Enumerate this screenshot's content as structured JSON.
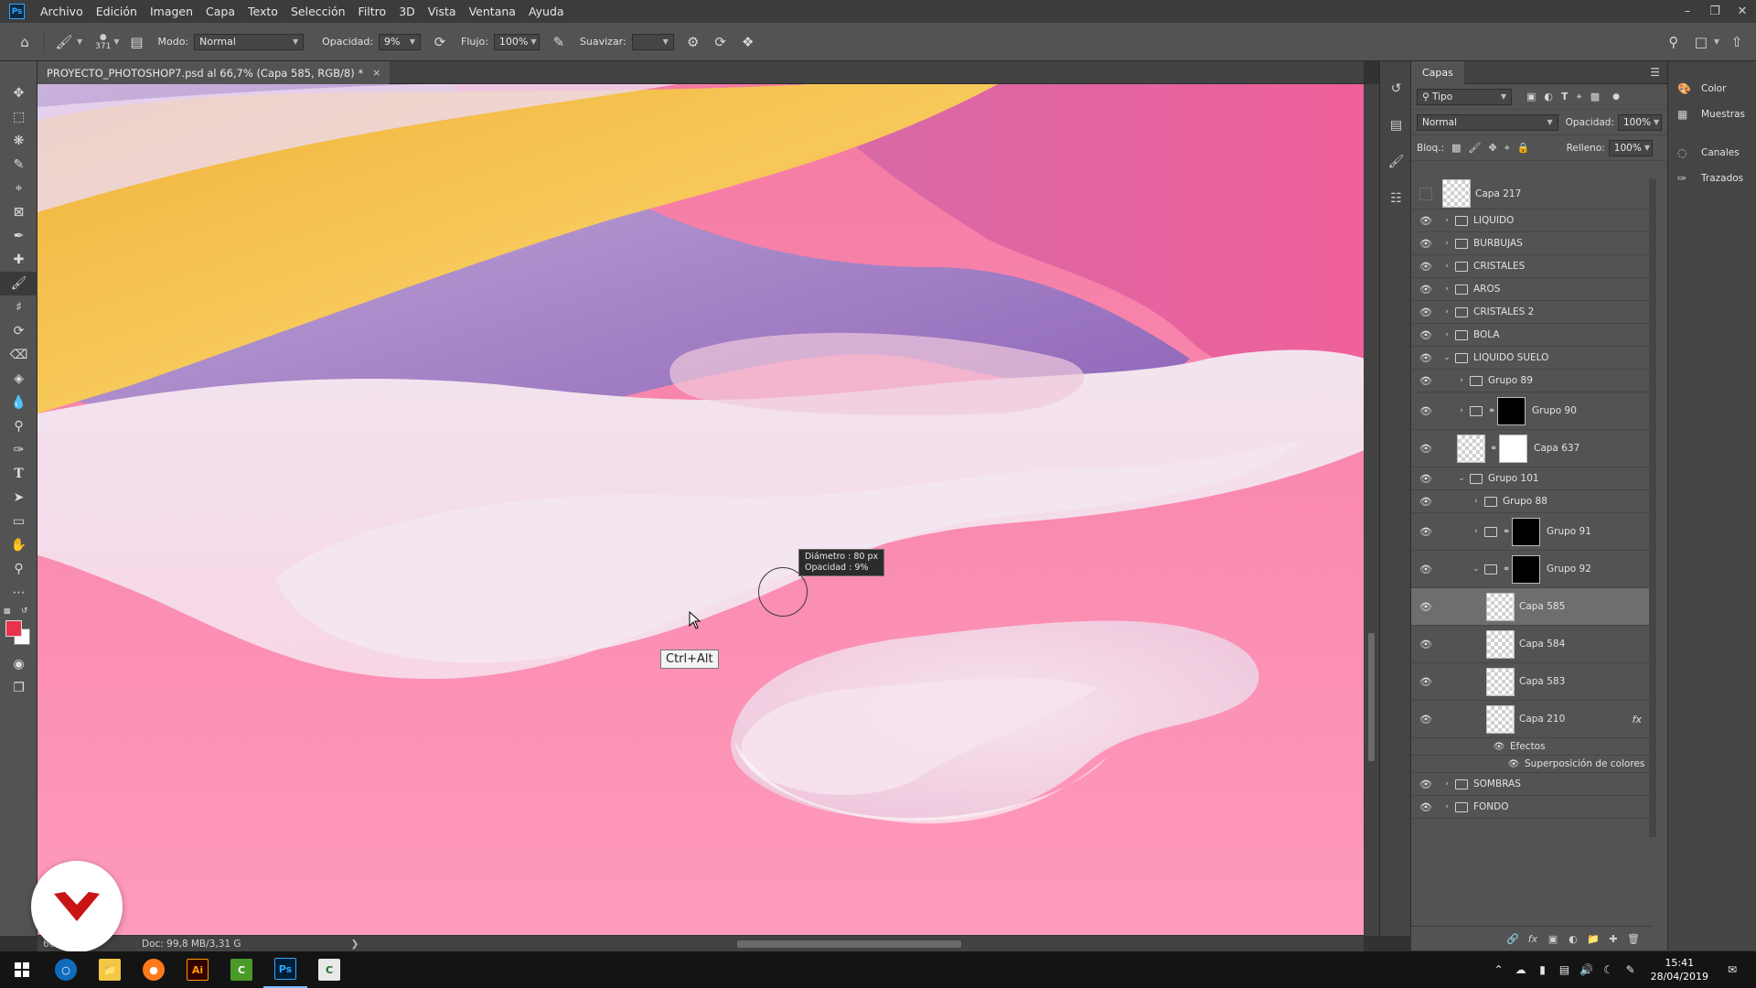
{
  "app": {
    "logo_text": "Ps"
  },
  "menu": [
    "Archivo",
    "Edición",
    "Imagen",
    "Capa",
    "Texto",
    "Selección",
    "Filtro",
    "3D",
    "Vista",
    "Ventana",
    "Ayuda"
  ],
  "options": {
    "brush_size": "371",
    "mode_label": "Modo:",
    "mode_value": "Normal",
    "opacity_label": "Opacidad:",
    "opacity_value": "9%",
    "flow_label": "Flujo:",
    "flow_value": "100%",
    "smooth_label": "Suavizar:",
    "smooth_value": ""
  },
  "document": {
    "tab_title": "PROYECTO_PHOTOSHOP7.psd al 66,7% (Capa 585, RGB/8) *",
    "close_glyph": "×",
    "status_zoom": "66,67%",
    "status_doc": "Doc: 99,8 MB/3,31 G"
  },
  "brush_readout": {
    "diameter_label": "Diámetro :",
    "diameter_value": "80 px",
    "opacity_label": "Opacidad :",
    "opacity_value": "9%"
  },
  "key_tip": "Ctrl+Alt",
  "colors": {
    "foreground": "#e8334a",
    "background": "#ffffff",
    "accent": "#31a8ff"
  },
  "layers_panel": {
    "tab": "Capas",
    "filter_value": "Tipo",
    "blend_mode": "Normal",
    "opacity_label": "Opacidad:",
    "opacity_value": "100%",
    "lock_label": "Bloq.:",
    "fill_label": "Relleno:",
    "fill_value": "100%",
    "layers": [
      {
        "name": "Capa 217",
        "kind": "layer",
        "indent": 0,
        "visible": false,
        "height": 34
      },
      {
        "name": "LIQUIDO",
        "kind": "group",
        "indent": 0,
        "expanded": false,
        "visible": true,
        "height": 25
      },
      {
        "name": "BURBUJAS",
        "kind": "group",
        "indent": 0,
        "expanded": false,
        "visible": true,
        "height": 25
      },
      {
        "name": "CRISTALES",
        "kind": "group",
        "indent": 0,
        "expanded": false,
        "visible": true,
        "height": 25
      },
      {
        "name": "AROS",
        "kind": "group",
        "indent": 0,
        "expanded": false,
        "visible": true,
        "height": 25
      },
      {
        "name": "CRISTALES 2",
        "kind": "group",
        "indent": 0,
        "expanded": false,
        "visible": true,
        "height": 25
      },
      {
        "name": "BOLA",
        "kind": "group",
        "indent": 0,
        "expanded": false,
        "visible": true,
        "height": 25
      },
      {
        "name": "LIQUIDO SUELO",
        "kind": "group",
        "indent": 0,
        "expanded": true,
        "visible": true,
        "height": 25
      },
      {
        "name": "Grupo 89",
        "kind": "group",
        "indent": 1,
        "expanded": false,
        "visible": true,
        "height": 25
      },
      {
        "name": "Grupo 90",
        "kind": "group-mask",
        "indent": 1,
        "expanded": false,
        "visible": true,
        "height": 41,
        "mask": "black"
      },
      {
        "name": "Capa 637",
        "kind": "layer-mask",
        "indent": 1,
        "visible": true,
        "height": 41,
        "mask": "white"
      },
      {
        "name": "Grupo 101",
        "kind": "group",
        "indent": 1,
        "expanded": true,
        "visible": true,
        "height": 25
      },
      {
        "name": "Grupo 88",
        "kind": "group",
        "indent": 2,
        "expanded": false,
        "visible": true,
        "height": 25
      },
      {
        "name": "Grupo 91",
        "kind": "group-mask",
        "indent": 2,
        "expanded": false,
        "visible": true,
        "height": 41,
        "mask": "black"
      },
      {
        "name": "Grupo 92",
        "kind": "group-mask",
        "indent": 2,
        "expanded": true,
        "visible": true,
        "height": 41,
        "mask": "black"
      },
      {
        "name": "Capa 585",
        "kind": "layer",
        "indent": 3,
        "visible": true,
        "height": 41,
        "selected": true
      },
      {
        "name": "Capa 584",
        "kind": "layer",
        "indent": 3,
        "visible": true,
        "height": 41
      },
      {
        "name": "Capa 583",
        "kind": "layer",
        "indent": 3,
        "visible": true,
        "height": 41
      },
      {
        "name": "Capa 210",
        "kind": "layer",
        "indent": 3,
        "visible": true,
        "height": 41,
        "fx": "fx"
      },
      {
        "name": "Efectos",
        "kind": "effect",
        "indent": 4,
        "visible": true,
        "height": 19
      },
      {
        "name": "Superposición de colores",
        "kind": "effect",
        "indent": 5,
        "visible": true,
        "height": 19
      },
      {
        "name": "SOMBRAS",
        "kind": "group",
        "indent": 0,
        "expanded": false,
        "visible": true,
        "height": 25
      },
      {
        "name": "FONDO",
        "kind": "group",
        "indent": 0,
        "expanded": false,
        "visible": true,
        "height": 25
      }
    ]
  },
  "mini_panels": [
    "Color",
    "Muestras",
    "Canales",
    "Trazados"
  ],
  "taskbar": {
    "apps": [
      "windows-start",
      "cortana",
      "file-explorer",
      "firefox",
      "illustrator",
      "camtasia",
      "photoshop",
      "camtasia-recorder"
    ],
    "illustrator_label": "Ai",
    "photoshop_label": "Ps",
    "time": "15:41",
    "date": "28/04/2019"
  }
}
